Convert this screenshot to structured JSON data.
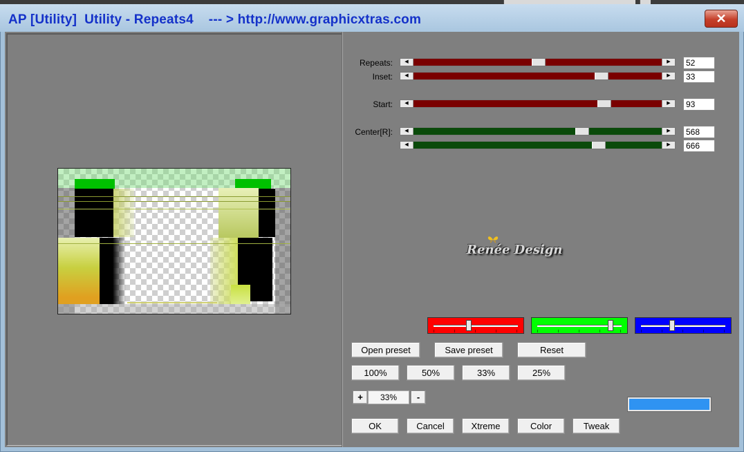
{
  "window": {
    "title": "AP [Utility]  Utility - Repeats4    --- > http://www.graphicxtras.com",
    "close_symbol": "✕"
  },
  "sliders": [
    {
      "label": "Repeats:",
      "value": "52",
      "fill_color": "#7a0000",
      "position": 0.5
    },
    {
      "label": "Inset:",
      "value": "33",
      "fill_color": "#7a0000",
      "position": 0.75
    },
    {
      "label": "Start:",
      "value": "93",
      "fill_color": "#7a0000",
      "position": 0.76
    },
    {
      "label": "Center[R]:",
      "value": "568",
      "fill_color": "#0a4a0a",
      "position": 0.67
    },
    {
      "label": "",
      "value": "666",
      "fill_color": "#0a4a0a",
      "position": 0.71
    }
  ],
  "logo_text": "Renée Design",
  "color_sliders": [
    {
      "color": "#ff0000",
      "level": 0.4,
      "icon": "red-channel"
    },
    {
      "color": "#00ff00",
      "level": 0.85,
      "icon": "green-channel"
    },
    {
      "color": "#0000ff",
      "level": 0.4,
      "icon": "blue-channel"
    }
  ],
  "preset_buttons": {
    "open": "Open preset",
    "save": "Save preset",
    "reset": "Reset"
  },
  "zoom_buttons": [
    "100%",
    "50%",
    "33%",
    "25%"
  ],
  "zoom": {
    "plus": "+",
    "value": "33%",
    "minus": "-"
  },
  "color_swatch": "#2f93f2",
  "action_buttons": [
    "OK",
    "Cancel",
    "Xtreme",
    "Color",
    "Tweak"
  ]
}
